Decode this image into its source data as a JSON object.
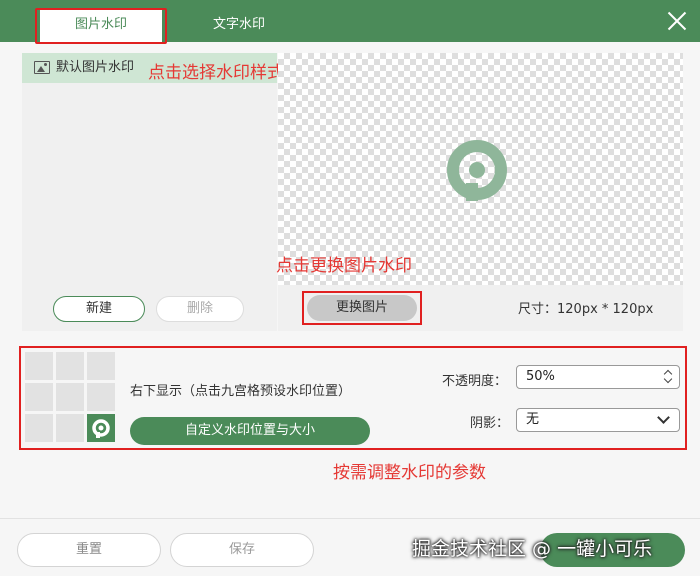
{
  "tabs": [
    {
      "label": "图片水印",
      "active": true
    },
    {
      "label": "文字水印",
      "active": false
    }
  ],
  "sidebar": {
    "item_label": "默认图片水印",
    "new_button": "新建",
    "delete_button": "删除"
  },
  "preview": {
    "change_image_button": "更换图片",
    "size_label": "尺寸：120px * 120px"
  },
  "annotations": {
    "choose_style": "点击选择水印样式",
    "change_image": "点击更换图片水印",
    "adjust_params": "按需调整水印的参数"
  },
  "settings": {
    "position_text": "右下显示（点击九宫格预设水印位置）",
    "custom_button": "自定义水印位置与大小",
    "opacity_label": "不透明度：",
    "opacity_value": "50%",
    "shadow_label": "阴影：",
    "shadow_value": "无"
  },
  "footer": {
    "reset_button": "重置",
    "save_button": "保存",
    "credit": "掘金技术社区 @ 一罐小可乐"
  },
  "colors": {
    "brand_green": "#4b8b59",
    "annotation_red": "#e53935",
    "selected_item_bg": "#cfe6d4"
  }
}
